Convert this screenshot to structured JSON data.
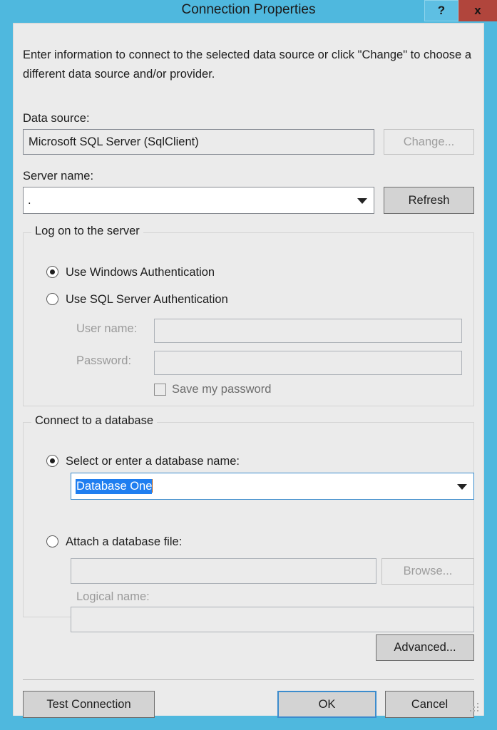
{
  "window": {
    "title": "Connection Properties",
    "help_label": "?",
    "close_label": "x",
    "titlebar_color": "#4fb8de",
    "close_color": "#b1453c",
    "client_color": "#ebebeb",
    "accent_color": "#3c8ccd",
    "selection_color": "#1f7ef0"
  },
  "intro": {
    "text": "Enter information to connect to the selected data source or click \"Change\" to choose a different data source and/or provider."
  },
  "data_source": {
    "label": "Data source:",
    "value": "Microsoft SQL Server (SqlClient)",
    "change_button": "Change...",
    "change_enabled": false
  },
  "server": {
    "label": "Server name:",
    "value": ".",
    "refresh_button": "Refresh",
    "dropdown_icon": "chevron-down-icon"
  },
  "logon_group": {
    "title": "Log on to the server",
    "options": [
      {
        "label": "Use Windows Authentication",
        "selected": true
      },
      {
        "label": "Use SQL Server Authentication",
        "selected": false
      }
    ],
    "user_name_label": "User name:",
    "user_name_value": "",
    "password_label": "Password:",
    "password_value": "",
    "save_password_label": "Save my password",
    "save_password_checked": false,
    "fields_enabled": false
  },
  "database_group": {
    "title": "Connect to a database",
    "select_option": {
      "label": "Select or enter a database name:",
      "selected": true,
      "value": "Database One",
      "value_selected_text": true,
      "dropdown_icon": "chevron-down-icon"
    },
    "attach_option": {
      "label": "Attach a database file:",
      "selected": false,
      "file_value": "",
      "browse_button": "Browse...",
      "logical_name_label": "Logical name:",
      "logical_name_value": "",
      "fields_enabled": false
    }
  },
  "footer": {
    "advanced_button": "Advanced...",
    "test_connection_button": "Test Connection",
    "ok_button": "OK",
    "cancel_button": "Cancel",
    "ok_is_default": true,
    "resize_grip_icon": "resize-grip-icon"
  }
}
